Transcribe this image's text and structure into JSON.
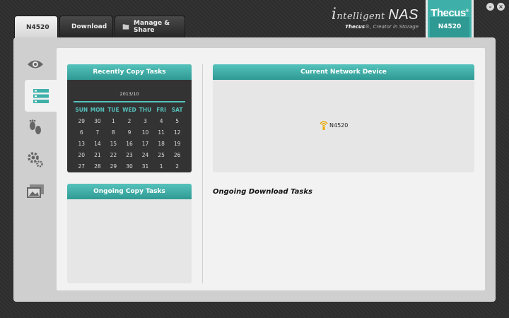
{
  "tabs": [
    {
      "label": "N4520",
      "icon": "home-icon",
      "active": true
    },
    {
      "label": "Download",
      "icon": "download-icon",
      "active": false
    },
    {
      "label": "Manage & Share",
      "icon": "folder-icon",
      "active": false
    }
  ],
  "brand": {
    "title_prefix": "i",
    "title_mid": "ntelligent ",
    "title_big": "NAS",
    "subtitle_brand": "Thecus",
    "subtitle_rest": "®, Creator in Storage",
    "logo_name": "Thecus",
    "logo_mark": "®",
    "logo_model": "N4520"
  },
  "sidebar": {
    "items": [
      {
        "icon": "eye-icon",
        "active": false
      },
      {
        "icon": "task-list-icon",
        "active": true
      },
      {
        "icon": "footprints-icon",
        "active": false
      },
      {
        "icon": "settings-gears-icon",
        "active": false
      },
      {
        "icon": "photos-icon",
        "active": false
      }
    ]
  },
  "recent_copy": {
    "title": "Recently Copy Tasks",
    "month": "2013/10",
    "weekdays": [
      "SUN",
      "MON",
      "TUE",
      "WED",
      "THU",
      "FRI",
      "SAT"
    ],
    "weeks": [
      [
        "29",
        "30",
        "1",
        "2",
        "3",
        "4",
        "5"
      ],
      [
        "6",
        "7",
        "8",
        "9",
        "10",
        "11",
        "12"
      ],
      [
        "13",
        "14",
        "15",
        "16",
        "17",
        "18",
        "19"
      ],
      [
        "20",
        "21",
        "22",
        "23",
        "24",
        "25",
        "26"
      ],
      [
        "27",
        "28",
        "29",
        "30",
        "31",
        "1",
        "2"
      ]
    ]
  },
  "ongoing_copy": {
    "title": "Ongoing Copy Tasks"
  },
  "network": {
    "title": "Current Network Device",
    "device_label": "N4520",
    "device_icon": "wifi-device-icon"
  },
  "downloads": {
    "title": "Ongoing Download Tasks"
  },
  "colors": {
    "accent": "#3fb0a9",
    "background": "#2e2e2e",
    "panel": "#e6e6e6"
  }
}
